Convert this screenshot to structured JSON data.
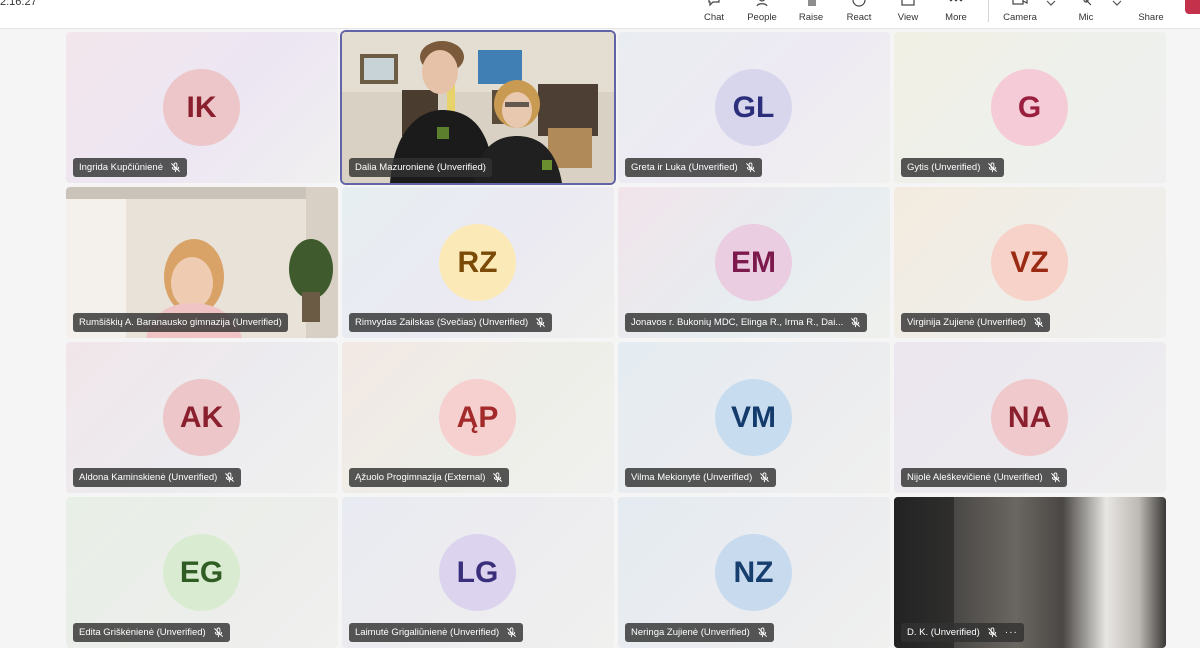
{
  "clock": "2:16:27",
  "toolbar": [
    {
      "label": "Chat",
      "icon": "chat-icon"
    },
    {
      "label": "People",
      "icon": "people-icon"
    },
    {
      "label": "Raise",
      "icon": "raise-hand-icon"
    },
    {
      "label": "React",
      "icon": "react-icon"
    },
    {
      "label": "View",
      "icon": "view-icon"
    },
    {
      "label": "More",
      "icon": "more-icon"
    },
    {
      "label": "Camera",
      "icon": "camera-icon"
    },
    {
      "label": "Mic",
      "icon": "mic-icon"
    },
    {
      "label": "Share",
      "icon": "share-icon"
    }
  ],
  "participants": [
    {
      "initials": "IK",
      "name": "Ingrida Kupčiūnienė",
      "muted": true,
      "avatar_bg": "#ecc6c9",
      "avatar_fg": "#8a1f2e"
    },
    {
      "initials": "",
      "name": "Dalia Mazuronienė (Unverified)",
      "muted": false,
      "video": true
    },
    {
      "initials": "GL",
      "name": "Greta ir Luka (Unverified)",
      "muted": true,
      "avatar_bg": "#d7d6ec",
      "avatar_fg": "#2b2e7a"
    },
    {
      "initials": "G",
      "name": "Gytis (Unverified)",
      "muted": true,
      "avatar_bg": "#f4cbd7",
      "avatar_fg": "#9a1e3e"
    },
    {
      "initials": "",
      "name": "Rumšiškių A. Baranausko gimnazija (Unverified)",
      "muted": false,
      "video": true
    },
    {
      "initials": "RZ",
      "name": "Rimvydas Zailskas (Svečias) (Unverified)",
      "muted": true,
      "avatar_bg": "#fbe9b8",
      "avatar_fg": "#7a4a06"
    },
    {
      "initials": "EM",
      "name": "Jonavos r. Bukonių MDC, Elinga R., Irma R., Dai...",
      "muted": true,
      "avatar_bg": "#eacde0",
      "avatar_fg": "#7c1a4e"
    },
    {
      "initials": "VZ",
      "name": "Virginija Zujienė (Unverified)",
      "muted": true,
      "avatar_bg": "#f6d2c8",
      "avatar_fg": "#9a2a12"
    },
    {
      "initials": "AK",
      "name": "Aldona Kaminskienė (Unverified)",
      "muted": true,
      "avatar_bg": "#ecc6c9",
      "avatar_fg": "#8a1f2e"
    },
    {
      "initials": "ĄP",
      "name": "Ąžuolo Progimnazija (External)",
      "muted": true,
      "avatar_bg": "#f6cfcf",
      "avatar_fg": "#a32a2a"
    },
    {
      "initials": "VM",
      "name": "Vilma Mekionytė (Unverified)",
      "muted": true,
      "avatar_bg": "#c7dcee",
      "avatar_fg": "#133b6b"
    },
    {
      "initials": "NA",
      "name": "Nijolė Aleškevičienė (Unverified)",
      "muted": true,
      "avatar_bg": "#efc9cc",
      "avatar_fg": "#8a1f2e"
    },
    {
      "initials": "EG",
      "name": "Edita Griškėnienė (Unverified)",
      "muted": true,
      "avatar_bg": "#d9ecd1",
      "avatar_fg": "#2f5d23"
    },
    {
      "initials": "LG",
      "name": "Laimutė Grigaliūnienė (Unverified)",
      "muted": true,
      "avatar_bg": "#dcd4ee",
      "avatar_fg": "#3a2f7a"
    },
    {
      "initials": "NZ",
      "name": "Neringa Zujienė (Unverified)",
      "muted": true,
      "avatar_bg": "#c8daee",
      "avatar_fg": "#163e6e"
    },
    {
      "initials": "",
      "name": "D. K. (Unverified)",
      "muted": true,
      "video": true,
      "more": "···"
    }
  ]
}
